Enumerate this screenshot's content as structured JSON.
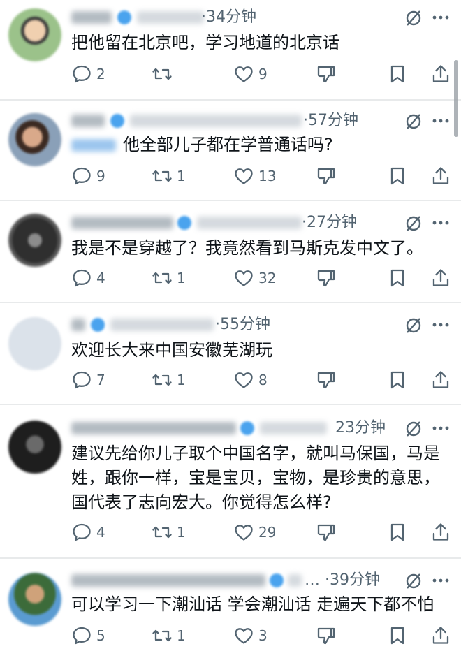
{
  "tweets": [
    {
      "time": "·34分钟",
      "text": "把他留在北京吧，学习地道的北京话",
      "replies": "2",
      "retweets": "",
      "likes": "9"
    },
    {
      "time": "·57分钟",
      "text": "他全部儿子都在学普通话吗?",
      "replies": "9",
      "retweets": "1",
      "likes": "13"
    },
    {
      "time": "·27分钟",
      "text": "我是不是穿越了？我竟然看到马斯克发中文了。",
      "replies": "4",
      "retweets": "1",
      "likes": "32"
    },
    {
      "time": "·55分钟",
      "text": "欢迎长大来中国安徽芜湖玩",
      "replies": "7",
      "retweets": "1",
      "likes": "8"
    },
    {
      "time": "23分钟",
      "text": "建议先给你儿子取个中国名字，就叫马保国，马是姓，跟你一样，宝是宝贝，宝物，是珍贵的意思，国代表了志向宏大。你觉得怎么样?",
      "replies": "4",
      "retweets": "1",
      "likes": "29"
    },
    {
      "time": "… ·39分钟",
      "text": "可以学习一下潮汕话 学会潮汕话 走遍天下都不怕",
      "replies": "5",
      "retweets": "1",
      "likes": "3"
    }
  ],
  "icons": {
    "reply": "reply-bubble-icon",
    "retweet": "retweet-icon",
    "like": "heart-icon",
    "dislike": "thumbs-down-icon",
    "bookmark": "bookmark-icon",
    "share": "share-icon",
    "mute": "mute-circle-slash-icon",
    "more": "more-dots-icon"
  },
  "colors": {
    "text": "#0f1419",
    "secondary": "#536471",
    "verified": "#1d9bf0",
    "divider": "#e8eaeb"
  }
}
